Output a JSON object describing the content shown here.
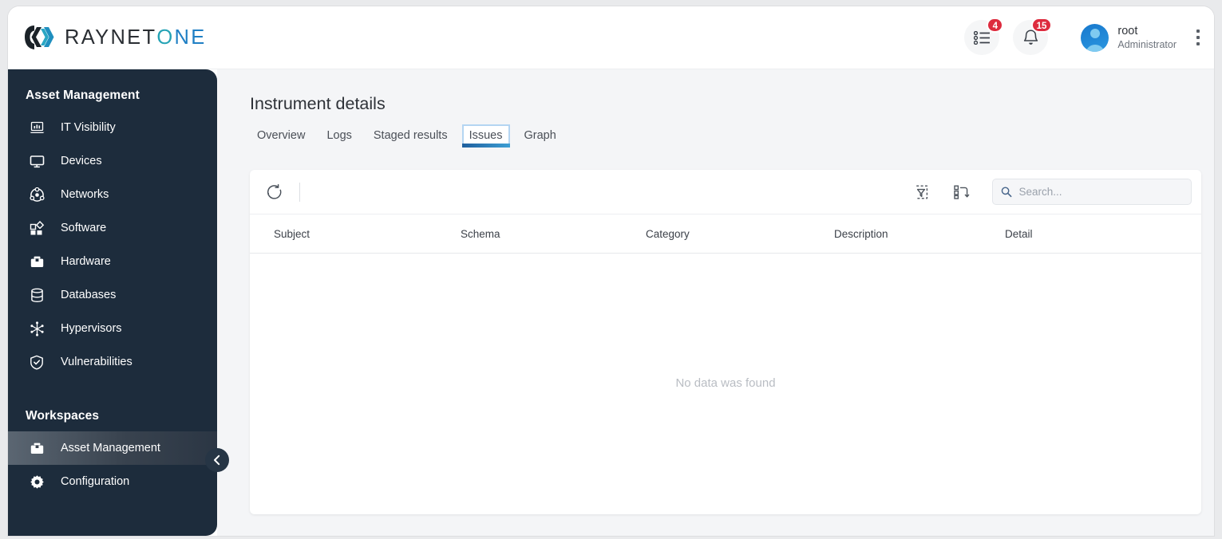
{
  "header": {
    "logo": {
      "part1": "RAYNET",
      "part2": "ONE"
    },
    "tasks_badge": "4",
    "notifications_badge": "15",
    "user_name": "root",
    "user_role": "Administrator"
  },
  "sidebar": {
    "section_title": "Asset Management",
    "items": [
      {
        "label": "IT Visibility",
        "icon": "laptop-chart-icon"
      },
      {
        "label": "Devices",
        "icon": "monitor-icon"
      },
      {
        "label": "Networks",
        "icon": "network-hub-icon"
      },
      {
        "label": "Software",
        "icon": "software-grid-icon"
      },
      {
        "label": "Hardware",
        "icon": "toolbox-icon"
      },
      {
        "label": "Databases",
        "icon": "database-icon"
      },
      {
        "label": "Hypervisors",
        "icon": "hypervisor-icon"
      },
      {
        "label": "Vulnerabilities",
        "icon": "shield-check-icon"
      }
    ],
    "workspaces_title": "Workspaces",
    "workspaces": [
      {
        "label": "Asset Management",
        "icon": "toolbox-icon",
        "active": true
      },
      {
        "label": "Configuration",
        "icon": "gear-icon",
        "active": false
      }
    ]
  },
  "main": {
    "page_title": "Instrument details",
    "tabs": [
      {
        "label": "Overview",
        "active": false
      },
      {
        "label": "Logs",
        "active": false
      },
      {
        "label": "Staged results",
        "active": false
      },
      {
        "label": "Issues",
        "active": true
      },
      {
        "label": "Graph",
        "active": false
      }
    ],
    "toolbar": {
      "refresh_label": "Refresh",
      "reset_filter_label": "Reset filter",
      "reset_columns_label": "Reset columns"
    },
    "search": {
      "value": "",
      "placeholder": "Search..."
    },
    "table": {
      "columns": [
        "Subject",
        "Schema",
        "Category",
        "Description",
        "Detail"
      ],
      "rows": [],
      "empty_message": "No data was found"
    }
  },
  "colors": {
    "sidebar_bg": "#1d2c3c",
    "badge_red": "#dd2b3e",
    "accent_blue": "#1f7fc4",
    "accent_teal": "#25a3b5",
    "tab_focus": "#b4d5f2"
  }
}
